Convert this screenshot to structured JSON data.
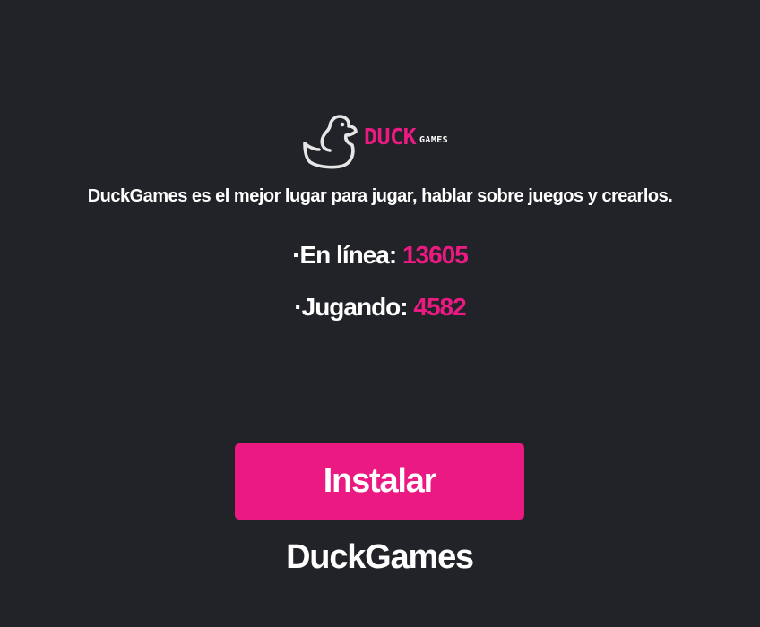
{
  "colors": {
    "background": "#222328",
    "accent": "#ea1a82",
    "text": "#ffffff",
    "logo_outline": "#e6e6e6"
  },
  "logo": {
    "icon": "duck-icon",
    "brand_primary": "DUCK",
    "brand_secondary": "GAMES"
  },
  "tagline": "DuckGames es el mejor lugar para jugar, hablar sobre juegos y crearlos.",
  "stats": {
    "online_label": "·En línea: ",
    "online_value": "13605",
    "playing_label": "·Jugando: ",
    "playing_value": "4582"
  },
  "install_button": {
    "label": "Instalar DuckGames"
  }
}
